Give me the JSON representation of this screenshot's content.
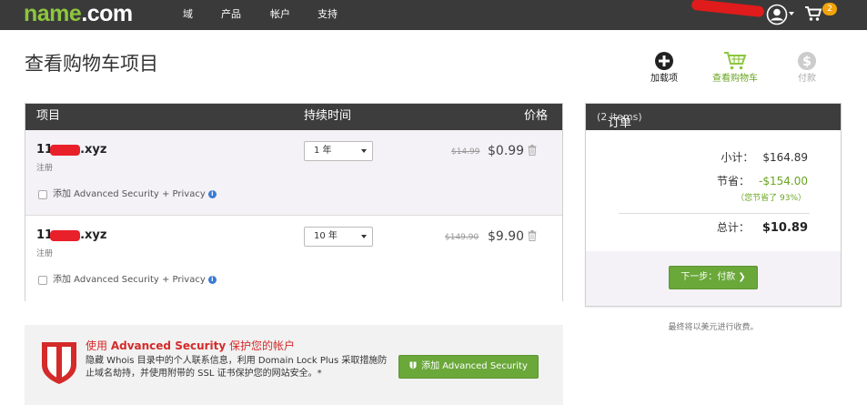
{
  "header": {
    "logo_part1": "name",
    "logo_part2": ".com",
    "nav": [
      "域",
      "产品",
      "帐户",
      "支持"
    ],
    "cart_count": "2"
  },
  "page": {
    "title": "查看购物车项目",
    "steps": [
      {
        "label": "加载项",
        "icon": "plus-circle-icon",
        "state": "done"
      },
      {
        "label": "查看购物车",
        "icon": "cart-icon",
        "state": "active"
      },
      {
        "label": "付款",
        "icon": "dollar-circle-icon",
        "state": "upcoming"
      }
    ]
  },
  "cart": {
    "headers": {
      "item": "项目",
      "duration": "持续时间",
      "price": "价格"
    },
    "rows": [
      {
        "domain_prefix": "11",
        "domain_suffix": ".xyz",
        "type": "注册",
        "duration": "1 年",
        "old_price": "$14.99",
        "price": "$0.99",
        "addon_label": "添加 Advanced Security + Privacy"
      },
      {
        "domain_prefix": "11",
        "domain_suffix": ".xyz",
        "type": "注册",
        "duration": "10 年",
        "old_price": "$149.90",
        "price": "$9.90",
        "addon_label": "添加 Advanced Security + Privacy"
      }
    ]
  },
  "summary": {
    "title": "订单汇总",
    "count": "(2 items)",
    "subtotal_label": "小计：",
    "subtotal": "$164.89",
    "savings_label": "节省：",
    "savings": "-$154.00",
    "savings_note": "（您节省了 93%）",
    "total_label": "总计：",
    "total": "$10.89",
    "next_button": "下一步：付款 ❯",
    "payment_note": "最终将以美元进行收费。"
  },
  "promo": {
    "title_prefix": "使用 ",
    "title_bold": "Advanced Security",
    "title_suffix": " 保护您的帐户",
    "description": "隐藏 Whois 目录中的个人联系信息，利用 Domain Lock Plus 采取措施防止域名劫持，并使用附带的 SSL 证书保护您的网站安全。*",
    "button": "添加 Advanced Security"
  },
  "colors": {
    "accent_green": "#6aa83a",
    "nav_bg": "#3a3a3a",
    "alert_red": "#d42a2a"
  }
}
